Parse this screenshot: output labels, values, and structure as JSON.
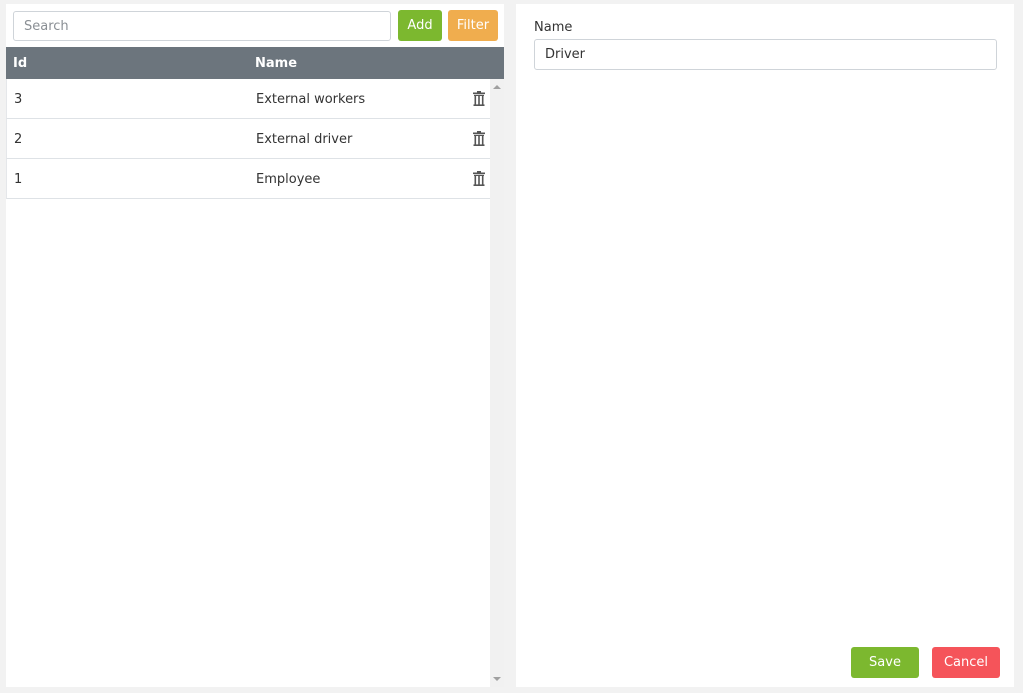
{
  "left": {
    "search": {
      "placeholder": "Search",
      "value": ""
    },
    "add_label": "Add",
    "filter_label": "Filter",
    "columns": {
      "id": "Id",
      "name": "Name"
    },
    "rows": [
      {
        "id": "3",
        "name": "External workers"
      },
      {
        "id": "2",
        "name": "External driver"
      },
      {
        "id": "1",
        "name": "Employee"
      }
    ]
  },
  "right": {
    "name_label": "Name",
    "name_value": "Driver",
    "save_label": "Save",
    "cancel_label": "Cancel"
  },
  "colors": {
    "add": "#7cb82f",
    "filter": "#f0ad4e",
    "header": "#6c757d",
    "save": "#7cb82f",
    "cancel": "#f5545a"
  },
  "icons": {
    "row_delete": "trash-icon"
  }
}
